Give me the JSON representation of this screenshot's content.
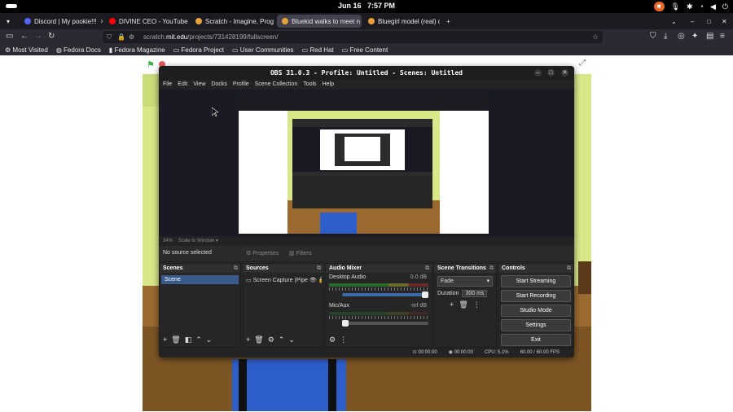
{
  "topbar": {
    "date": "Jun 16",
    "time": "7:57 PM",
    "recording": "■"
  },
  "tabs": [
    {
      "label": "Discord | My pookie!!!",
      "color": "#5865f2"
    },
    {
      "label": "DIVINE CEO - YouTube",
      "color": "#ff0000"
    },
    {
      "label": "Scratch - Imagine, Prog",
      "color": "#e8a23a"
    },
    {
      "label": "Bluekid walks to meet n",
      "color": "#e8a23a"
    },
    {
      "label": "Bluegirl model (real) on",
      "color": "#e8a23a"
    }
  ],
  "url": {
    "pre": "scratch.",
    "host": "mit.edu",
    "post": "/projects/731428199/fullscreen/"
  },
  "bookmarks": [
    "Most Visited",
    "Fedora Docs",
    "Fedora Magazine",
    "Fedora Project",
    "User Communities",
    "Red Hat",
    "Free Content"
  ],
  "obs": {
    "title": "OBS 31.0.3 - Profile: Untitled - Scenes: Untitled",
    "menu": [
      "File",
      "Edit",
      "View",
      "Docks",
      "Profile",
      "Scene Collection",
      "Tools",
      "Help"
    ],
    "zoom": "34%",
    "scale": "Scale to Window",
    "no_source": "No source selected",
    "properties": "Properties",
    "filters": "Filters",
    "scenes": {
      "title": "Scenes",
      "items": [
        "Scene"
      ]
    },
    "sources": {
      "title": "Sources",
      "items": [
        "Screen Capture (Pipe"
      ]
    },
    "mixer": {
      "title": "Audio Mixer",
      "ch1": "Desktop Audio",
      "ch1db": "0.0 dB",
      "ch2": "Mic/Aux",
      "ch2db": "-inf dB",
      "ch1_level": 1.0,
      "ch2_level": 0.0
    },
    "transitions": {
      "title": "Scene Transitions",
      "type": "Fade",
      "duration_label": "Duration",
      "duration": "300 ms"
    },
    "controls": {
      "title": "Controls",
      "buttons": [
        "Start Streaming",
        "Start Recording",
        "Studio Mode",
        "Settings",
        "Exit"
      ]
    },
    "footer": {
      "t1": "00:00:00",
      "t2": "00:00:00",
      "cpu": "CPU: 5.1%",
      "fps": "60.00 / 60.00 FPS"
    }
  }
}
